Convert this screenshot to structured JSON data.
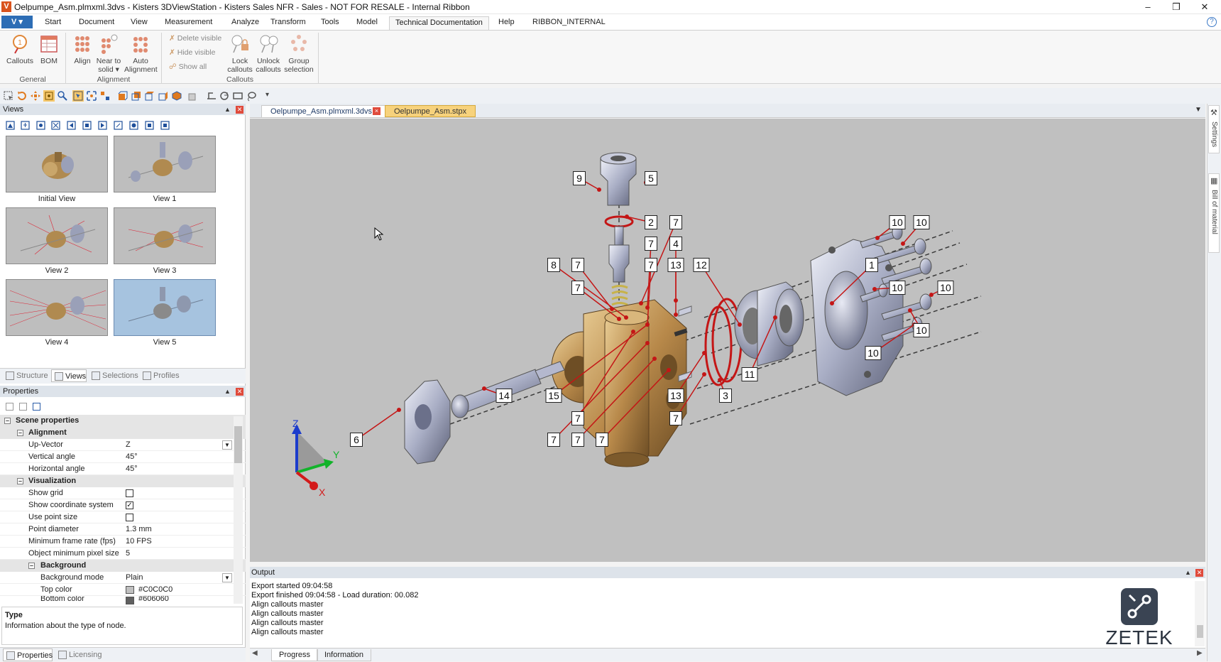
{
  "window": {
    "app_icon": "V",
    "title": "Oelpumpe_Asm.plmxml.3dvs - Kisters 3DViewStation - Kisters Sales NFR - Sales - NOT FOR RESALE - Internal Ribbon",
    "controls": [
      "–",
      "❒",
      "✕"
    ]
  },
  "ribbon": {
    "app_button": "V",
    "tabs": [
      "Start",
      "Document",
      "View",
      "Measurement",
      "Analyze",
      "Transform",
      "Tools",
      "Model",
      "Technical Documentation",
      "Help",
      "RIBBON_INTERNAL"
    ],
    "active_tab": "Technical Documentation",
    "help": "?",
    "groups": {
      "general": {
        "label": "General",
        "callouts": "Callouts",
        "bom": "BOM"
      },
      "alignment": {
        "label": "Alignment",
        "align": "Align",
        "near_l1": "Near to",
        "near_l2": "solid",
        "auto_l1": "Auto",
        "auto_l2": "Alignment"
      },
      "callouts": {
        "label": "Callouts",
        "delete_visible": "Delete visible",
        "hide_visible": "Hide visible",
        "show_all": "Show all",
        "lock_l1": "Lock",
        "lock_l2": "callouts",
        "unlock_l1": "Unlock",
        "unlock_l2": "callouts",
        "group_l1": "Group",
        "group_l2": "selection"
      }
    }
  },
  "views_panel": {
    "title": "Views",
    "thumbnails": [
      {
        "caption": "Initial View"
      },
      {
        "caption": "View 1"
      },
      {
        "caption": "View 2"
      },
      {
        "caption": "View 3"
      },
      {
        "caption": "View 4"
      },
      {
        "caption": "View 5",
        "selected": true
      }
    ],
    "tabs": [
      "Structure",
      "Views",
      "Selections",
      "Profiles"
    ],
    "active_tab": "Views"
  },
  "properties_panel": {
    "title": "Properties",
    "scene_properties": "Scene properties",
    "alignment": "Alignment",
    "up_vector_label": "Up-Vector",
    "up_vector_value": "Z",
    "vertical_angle_label": "Vertical angle",
    "vertical_angle_value": "45°",
    "horizontal_angle_label": "Horizontal angle",
    "horizontal_angle_value": "45°",
    "visualization": "Visualization",
    "show_grid_label": "Show grid",
    "show_grid": false,
    "show_coord_label": "Show coordinate system",
    "show_coord": true,
    "use_point_size_label": "Use point size",
    "use_point_size": false,
    "point_diameter_label": "Point diameter",
    "point_diameter_value": "1.3 mm",
    "min_fps_label": "Minimum frame rate (fps)",
    "min_fps_value": "10 FPS",
    "min_pixel_label": "Object minimum pixel size",
    "min_pixel_value": "5",
    "background": "Background",
    "bg_mode_label": "Background mode",
    "bg_mode_value": "Plain",
    "top_color_label": "Top color",
    "top_color_value": "#C0C0C0",
    "bottom_color_label": "Bottom color",
    "bottom_color_value": "#606060",
    "desc_title": "Type",
    "desc_text": "Information about the type of node.",
    "tabs": [
      "Properties",
      "Licensing"
    ]
  },
  "documents": {
    "tabs": [
      "Oelpumpe_Asm.plmxml.3dvs",
      "Oelpumpe_Asm.stpx"
    ],
    "close": "×"
  },
  "viewport": {
    "background": "#C0C0C0",
    "callouts": [
      {
        "label": "9"
      },
      {
        "label": "5"
      },
      {
        "label": "2"
      },
      {
        "label": "7"
      },
      {
        "label": "7"
      },
      {
        "label": "4"
      },
      {
        "label": "10"
      },
      {
        "label": "10"
      },
      {
        "label": "8"
      },
      {
        "label": "7"
      },
      {
        "label": "7"
      },
      {
        "label": "13"
      },
      {
        "label": "12"
      },
      {
        "label": "1"
      },
      {
        "label": "7"
      },
      {
        "label": "10"
      },
      {
        "label": "10"
      },
      {
        "label": "10"
      },
      {
        "label": "10"
      },
      {
        "label": "11"
      },
      {
        "label": "14"
      },
      {
        "label": "15"
      },
      {
        "label": "13"
      },
      {
        "label": "3"
      },
      {
        "label": "7"
      },
      {
        "label": "7"
      },
      {
        "label": "6"
      },
      {
        "label": "7"
      },
      {
        "label": "7"
      },
      {
        "label": "7"
      }
    ],
    "axes": {
      "z": "Z",
      "y": "Y",
      "x": "X"
    }
  },
  "side_tabs": [
    "Settings",
    "Bill of material"
  ],
  "output": {
    "title": "Output",
    "lines": [
      "Export started 09:04:58",
      "Export finished 09:04:58 - Load duration: 00.082",
      "Align callouts master",
      "Align callouts master",
      "Align callouts master",
      "Align callouts master"
    ],
    "tabs": [
      "Progress",
      "Information"
    ]
  },
  "watermark": {
    "text": "ZETEK"
  }
}
